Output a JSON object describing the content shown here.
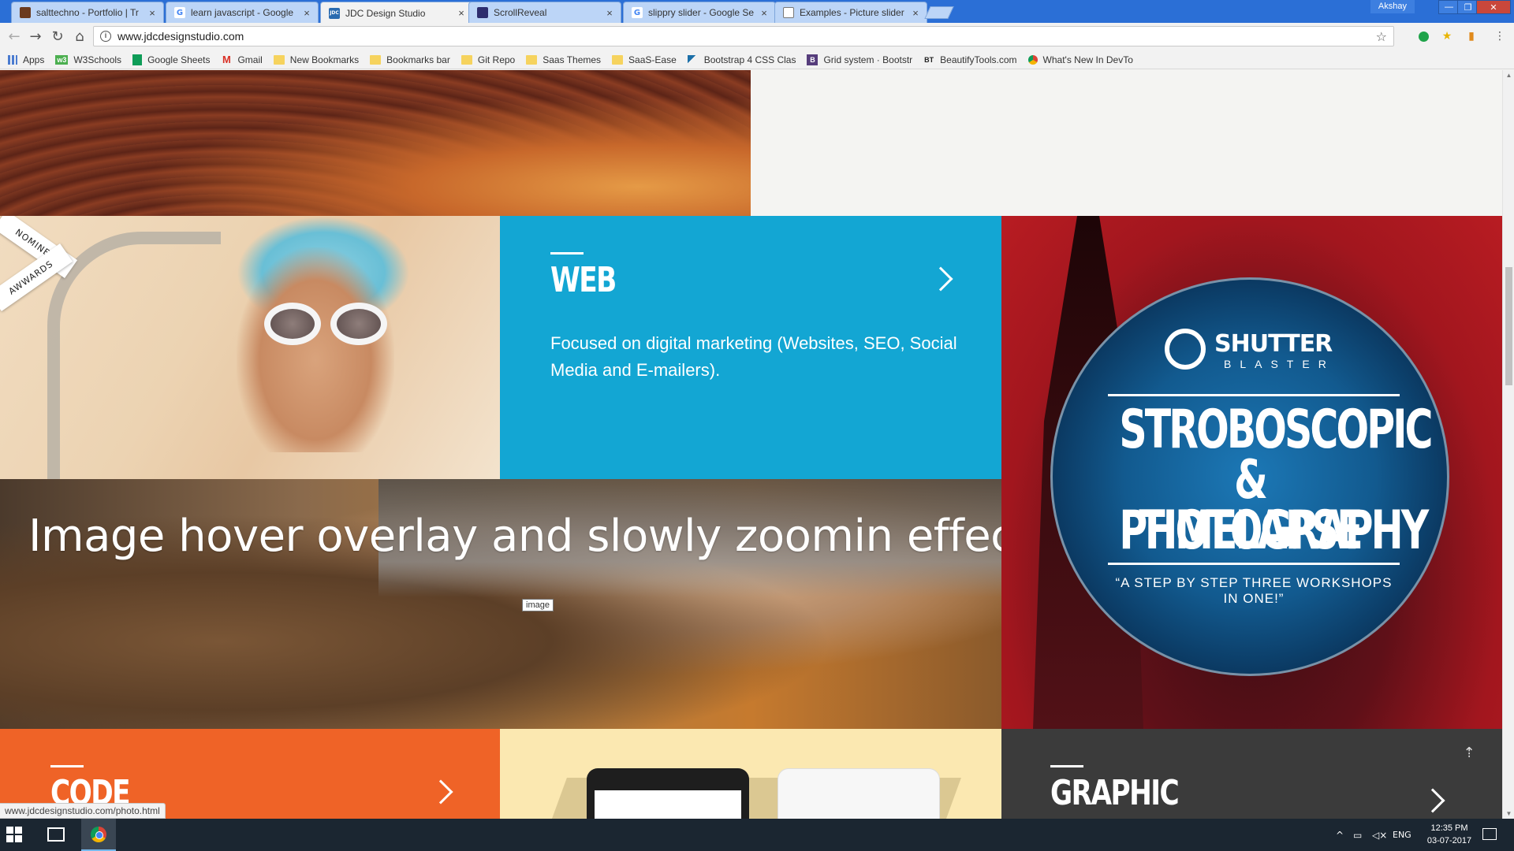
{
  "browser": {
    "tabs": [
      {
        "title": "salttechno - Portfolio | Tr",
        "favicon_color": "#6b3a1e",
        "favicon_glyph": "",
        "active": false
      },
      {
        "title": "learn javascript - Google",
        "favicon_color": "#ffffff",
        "favicon_glyph": "G",
        "active": false
      },
      {
        "title": "JDC Design Studio",
        "favicon_color": "#2a6bb0",
        "favicon_glyph": "JDC",
        "active": true
      },
      {
        "title": "ScrollReveal",
        "favicon_color": "#2d2d6e",
        "favicon_glyph": "",
        "active": false
      },
      {
        "title": "slippry slider - Google Se",
        "favicon_color": "#ffffff",
        "favicon_glyph": "G",
        "active": false
      },
      {
        "title": "Examples - Picture slider",
        "favicon_color": "#ffffff",
        "favicon_glyph": "",
        "active": false
      }
    ],
    "close_glyph": "×",
    "profile_name": "Akshay",
    "window_controls": {
      "minimize": "—",
      "maximize": "❐",
      "close": "✕"
    },
    "nav": {
      "back": "←",
      "forward": "→",
      "reload": "↻",
      "home": "⌂"
    },
    "url": "www.jdcdesignstudio.com",
    "star_glyph": "☆",
    "bookmarks": [
      {
        "label": "Apps",
        "icon": "apps-icon",
        "color": "#4a7bd0",
        "glyph": ""
      },
      {
        "label": "W3Schools",
        "icon": "w3schools-icon",
        "color": "#4caf50",
        "glyph": "w3"
      },
      {
        "label": "Google Sheets",
        "icon": "sheets-icon",
        "color": "#0f9d58",
        "glyph": ""
      },
      {
        "label": "Gmail",
        "icon": "gmail-icon",
        "color": "#d93025",
        "glyph": "M"
      },
      {
        "label": "New Bookmarks",
        "icon": "folder-icon",
        "color": "#f6d35e",
        "glyph": ""
      },
      {
        "label": "Bookmarks bar",
        "icon": "folder-icon",
        "color": "#f6d35e",
        "glyph": ""
      },
      {
        "label": "Git Repo",
        "icon": "folder-icon",
        "color": "#f6d35e",
        "glyph": ""
      },
      {
        "label": "Saas Themes",
        "icon": "folder-icon",
        "color": "#f6d35e",
        "glyph": ""
      },
      {
        "label": "SaaS-Ease",
        "icon": "folder-icon",
        "color": "#f6d35e",
        "glyph": ""
      },
      {
        "label": "Bootstrap 4 CSS Clas",
        "icon": "bootstrap-feather-icon",
        "color": "#1b6fa8",
        "glyph": ""
      },
      {
        "label": "Grid system · Bootstr",
        "icon": "bootstrap-icon",
        "color": "#563d7c",
        "glyph": "B"
      },
      {
        "label": "BeautifyTools.com",
        "icon": "beautifytools-icon",
        "color": "#222222",
        "glyph": "BT"
      },
      {
        "label": "What's New In DevTo",
        "icon": "chrome-icon",
        "color": "#4285f4",
        "glyph": ""
      }
    ],
    "status_url": "www.jdcdesignstudio.com/photo.html"
  },
  "page": {
    "ribbon": {
      "line1": "NOMINEE",
      "line2": "AWWARDS"
    },
    "web": {
      "heading": "WEB",
      "description": "Focused on digital marketing (Websites, SEO, Social Media and E-mailers).",
      "bg": "#13a6d3"
    },
    "shutter": {
      "brand": "SHUTTER",
      "brand_sub": "BLASTER",
      "headline": [
        "STROBOSCOPIC",
        "& TIMELAPSE",
        "PHOTOGRAPHY"
      ],
      "tagline": "“A STEP BY STEP THREE WORKSHOPS IN ONE!”"
    },
    "camel": {
      "overlay_text": "Image hover overlay and slowly zoomin effect",
      "tooltip": "image"
    },
    "code": {
      "heading": "CODE",
      "bg": "#ef6327"
    },
    "graphic": {
      "heading": "GRAPHIC",
      "bg": "#3b3b3b"
    },
    "scroll_top_glyph": "⇡"
  },
  "taskbar": {
    "tray_chevron": "^",
    "language": "ENG",
    "time": "12:35 PM",
    "date": "03-07-2017"
  }
}
